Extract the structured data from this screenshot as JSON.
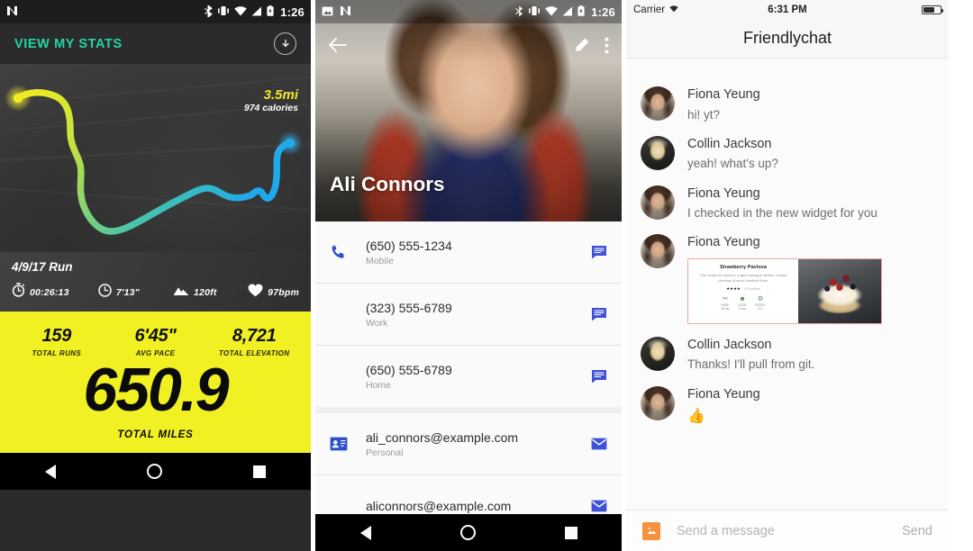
{
  "run_panel": {
    "status_bar": {
      "app_icon": "android-n-icon",
      "bluetooth": "bluetooth-icon",
      "vibrate": "vibrate-icon",
      "wifi": "wifi-icon",
      "signal": "signal-icon",
      "battery": "battery-icon",
      "clock": "1:26"
    },
    "topbar": {
      "title": "VIEW MY STATS",
      "download_icon": "download-circle-icon"
    },
    "map": {
      "distance": "3.5mi",
      "calories": "974 calories",
      "route_start_color": "#f2ec1f",
      "route_end_color": "#29a9e6"
    },
    "session": {
      "date_title": "4/9/17 Run",
      "metrics": [
        {
          "icon": "stopwatch-icon",
          "value": "00:26:13"
        },
        {
          "icon": "clock-icon",
          "value": "7'13\""
        },
        {
          "icon": "mountain-icon",
          "value": "120ft"
        },
        {
          "icon": "heart-icon",
          "value": "97bpm"
        }
      ]
    },
    "totals": {
      "background_color": "#f0f022",
      "cells": [
        {
          "value": "159",
          "label": "TOTAL RUNS"
        },
        {
          "value": "6'45\"",
          "label": "AVG PACE"
        },
        {
          "value": "8,721",
          "label": "TOTAL ELEVATION"
        }
      ],
      "headline_value": "650.9",
      "headline_label": "TOTAL MILES"
    },
    "nav_bar": {
      "back": "back-triangle-icon",
      "home": "home-circle-icon",
      "recents": "recents-square-icon"
    }
  },
  "contact_panel": {
    "status_bar": {
      "screenshot_icon": "image-icon",
      "app_icon": "android-n-icon",
      "bluetooth": "bluetooth-icon",
      "vibrate": "vibrate-icon",
      "wifi": "wifi-icon",
      "signal": "signal-icon",
      "battery": "battery-icon",
      "clock": "1:26"
    },
    "hero": {
      "back_icon": "arrow-back-icon",
      "edit_icon": "pencil-icon",
      "overflow_icon": "more-vert-icon",
      "name": "Ali Connors"
    },
    "rows": [
      {
        "lead_icon": "phone-icon",
        "value": "(650) 555-1234",
        "label": "Mobile",
        "trail_icon": "message-icon"
      },
      {
        "lead_icon": "",
        "value": "(323) 555-6789",
        "label": "Work",
        "trail_icon": "message-icon"
      },
      {
        "lead_icon": "",
        "value": "(650) 555-6789",
        "label": "Home",
        "trail_icon": "message-icon"
      },
      {
        "lead_icon": "contact-mail-icon",
        "value": "ali_connors@example.com",
        "label": "Personal",
        "trail_icon": "email-icon"
      },
      {
        "lead_icon": "",
        "value": "aliconnors@example.com",
        "label": "",
        "trail_icon": "email-icon"
      }
    ],
    "nav_bar": {
      "back": "back-triangle-icon",
      "home": "home-circle-icon",
      "recents": "recents-square-icon"
    }
  },
  "chat_panel": {
    "status_bar": {
      "carrier": "Carrier",
      "wifi_icon": "wifi-icon",
      "time": "6:31 PM",
      "battery_icon": "battery-icon"
    },
    "nav_title": "Friendlychat",
    "messages": [
      {
        "avatar": "fiona-avatar",
        "name": "Fiona Yeung",
        "text": "hi! yt?"
      },
      {
        "avatar": "collin-avatar",
        "name": "Collin Jackson",
        "text": "yeah! what's up?"
      },
      {
        "avatar": "fiona-avatar",
        "name": "Fiona Yeung",
        "text": "I checked in the new widget for you"
      },
      {
        "avatar": "fiona-avatar",
        "name": "Fiona Yeung",
        "text": "",
        "card": {
          "title": "Strawberry Pavlova",
          "description": "This recipe for pavlova, a light meringue dessert, comes courtesy of actor Geoffrey Rush.",
          "stars": "★★★★",
          "reviews": "170 reviews",
          "stats": [
            {
              "icon": "prep-icon",
              "line1": "PREP:",
              "line2": "25 min"
            },
            {
              "icon": "cook-icon",
              "line1": "COOK:",
              "line2": "1 hour"
            },
            {
              "icon": "serves-icon",
              "line1": "FEEDS:",
              "line2": "4-6"
            }
          ],
          "border_color": "#f0a5a8"
        }
      },
      {
        "avatar": "collin-avatar",
        "name": "Collin Jackson",
        "text": "Thanks! I'll pull from git."
      },
      {
        "avatar": "fiona-avatar",
        "name": "Fiona Yeung",
        "text": "",
        "emoji": "👍"
      }
    ],
    "input": {
      "image_icon": "image-attach-icon",
      "placeholder": "Send a message",
      "send_label": "Send"
    }
  }
}
